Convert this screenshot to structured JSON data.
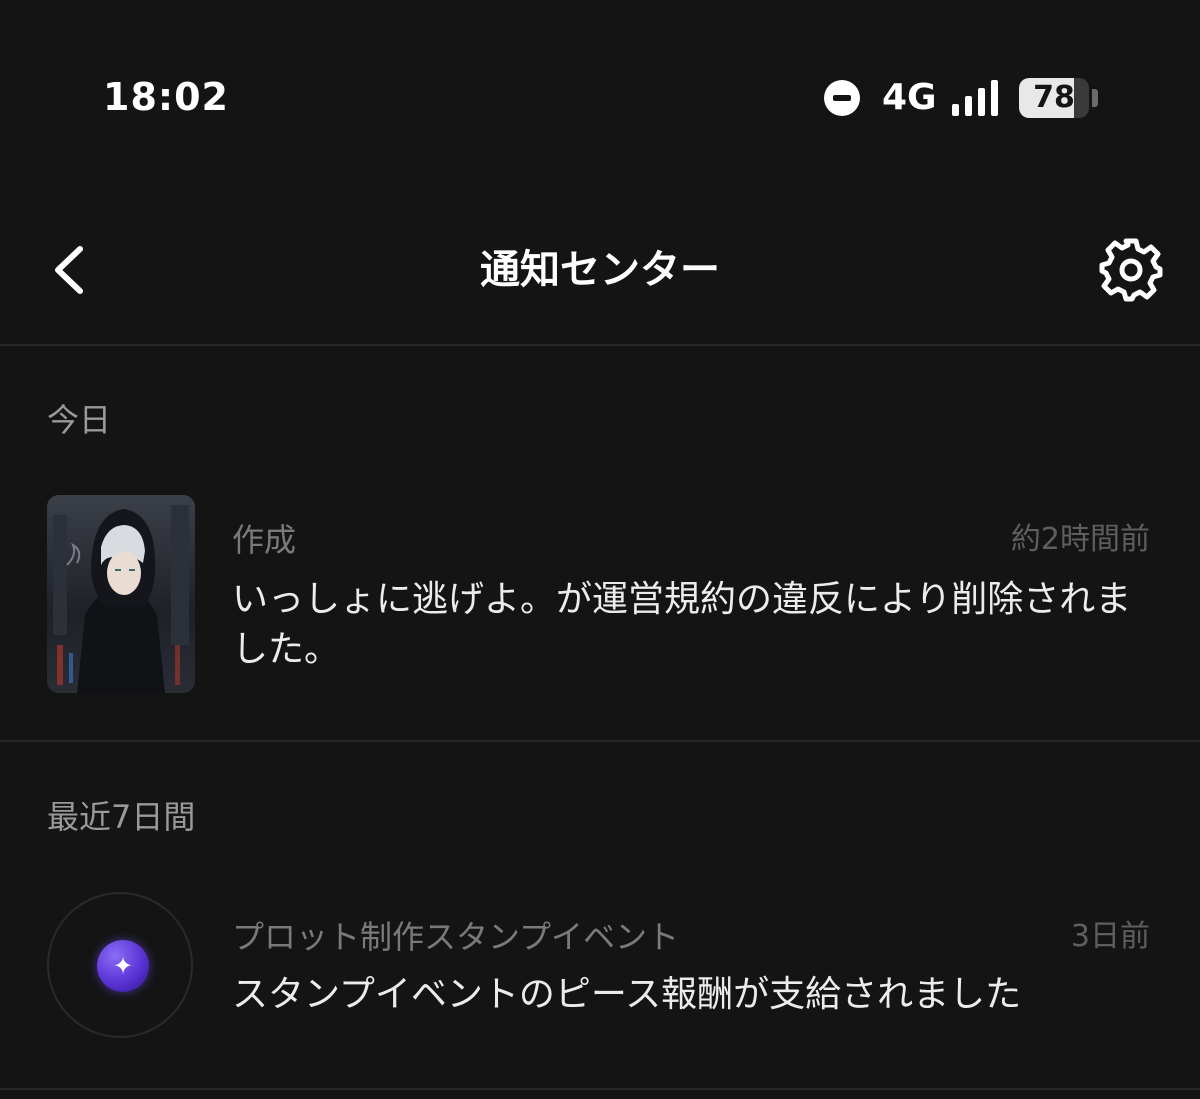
{
  "status_bar": {
    "time": "18:02",
    "network": "4G",
    "battery_level": "78",
    "battery_fraction": 0.78,
    "icons": [
      "do-not-disturb-icon",
      "signal-icon",
      "battery-icon"
    ]
  },
  "header": {
    "title": "通知センター",
    "back_icon": "chevron-left-icon",
    "settings_icon": "gear-icon"
  },
  "sections": [
    {
      "label": "今日",
      "items": [
        {
          "title": "作成",
          "time": "約2時間前",
          "body": "いっしょに逃げよ。が運営規約の違反により削除されました。",
          "thumbnail": "character-thumbnail"
        }
      ]
    },
    {
      "label": "最近7日間",
      "items": [
        {
          "title": "プロット制作スタンプイベント",
          "time": "3日前",
          "body": "スタンプイベントのピース報酬が支給されました",
          "thumbnail": "coin-icon"
        }
      ]
    }
  ],
  "colors": {
    "background": "#141414",
    "divider": "#262626",
    "section_label": "#9a9a9a",
    "body_text": "#ececec",
    "coin_accent": "#5b33d6"
  }
}
